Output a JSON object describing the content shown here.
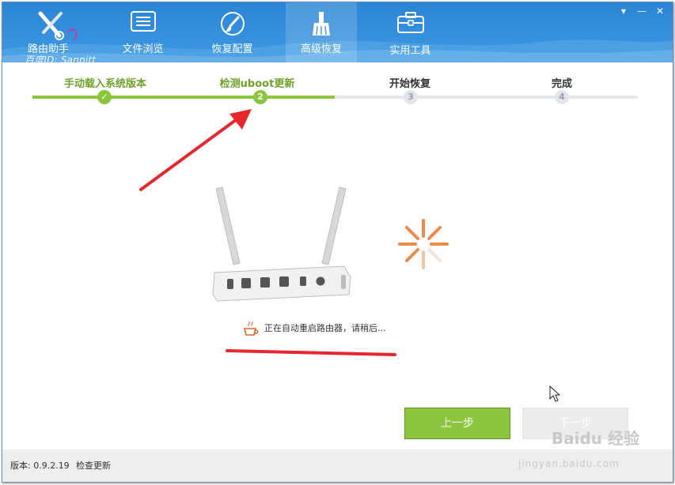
{
  "app": {
    "brand_name": "路由助手",
    "watermark_text": "百度ID: Sanpitt",
    "window_buttons": [
      "▾",
      "—",
      "✕"
    ]
  },
  "tabs": [
    {
      "label": "文件浏览",
      "icon": "file-list-icon",
      "active": false
    },
    {
      "label": "恢复配置",
      "icon": "paintbrush-icon",
      "active": false
    },
    {
      "label": "高级恢复",
      "icon": "broom-icon",
      "active": true
    },
    {
      "label": "实用工具",
      "icon": "toolbox-icon",
      "active": false
    }
  ],
  "steps": [
    {
      "label": "手动载入系统版本",
      "num": "✓",
      "state": "done"
    },
    {
      "label": "检测uboot更新",
      "num": "2",
      "state": "current"
    },
    {
      "label": "开始恢复",
      "num": "3",
      "state": "todo"
    },
    {
      "label": "完成",
      "num": "4",
      "state": "todo"
    }
  ],
  "progress_done_fraction": 0.5,
  "status_text": "正在自动重启路由器，请稍后...",
  "buttons": {
    "prev": "上一步",
    "next": "下一步"
  },
  "footer": {
    "version": "版本: 0.9.2.19",
    "check_update": "检查更新"
  },
  "watermark": {
    "baidu": "Baidu 经验",
    "site": "jingyan.baidu.com"
  },
  "colors": {
    "accent": "#8cc63f",
    "header": "#3a93de",
    "spinner": "#f08a4b",
    "annotation": "#e8262d"
  }
}
